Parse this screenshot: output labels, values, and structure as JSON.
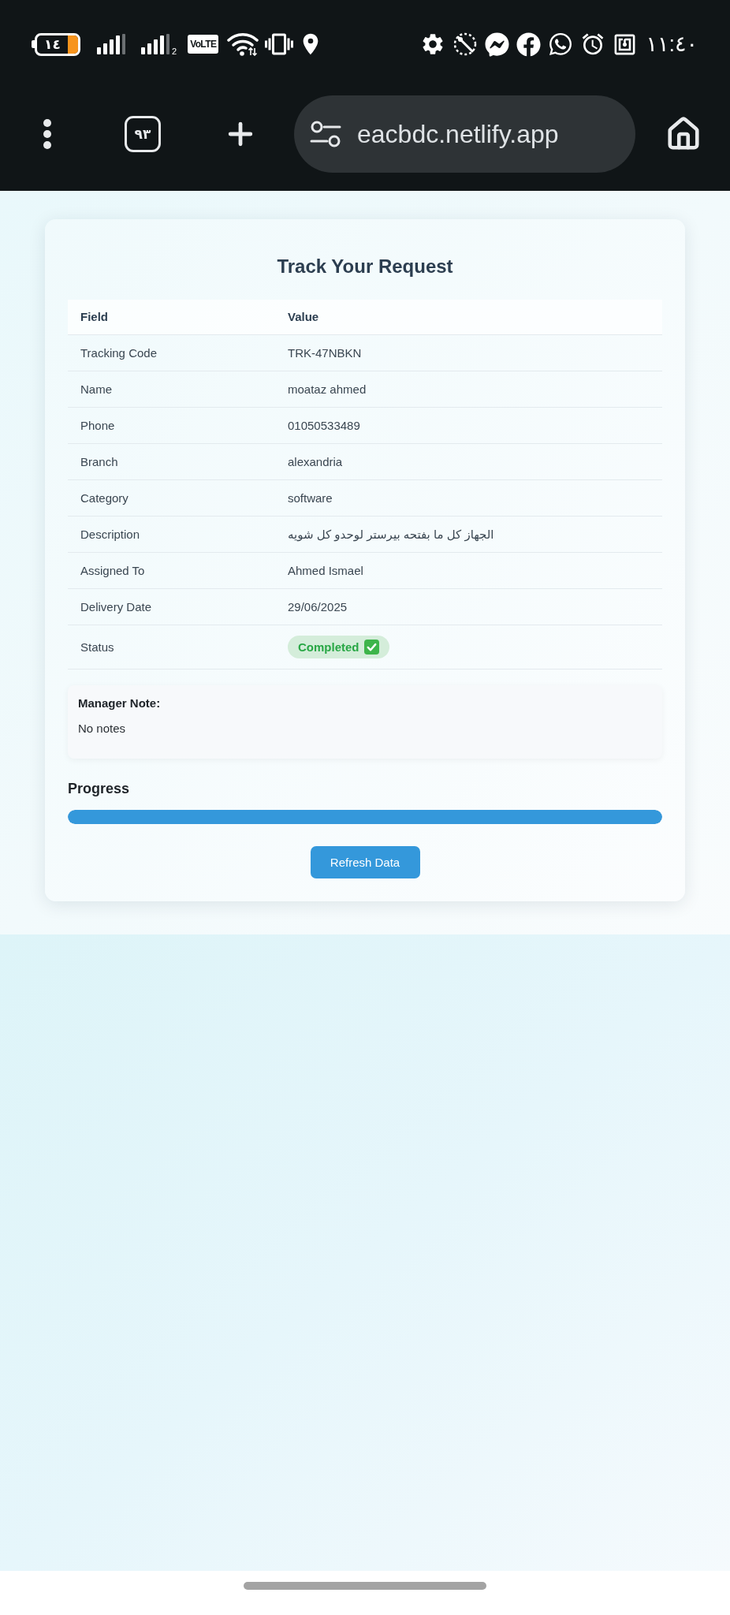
{
  "status_bar": {
    "battery": "١٤",
    "sim_slot": "2",
    "network": "VoLTE",
    "time": "١١:٤٠"
  },
  "browser_bar": {
    "tab_count": "٩٣",
    "url": "eacbdc.netlify.app"
  },
  "card": {
    "title": "Track Your Request",
    "table": {
      "columns": [
        "Field",
        "Value"
      ],
      "rows": [
        {
          "field": "Tracking Code",
          "value": "TRK-47NBKN",
          "kind": "text"
        },
        {
          "field": "Name",
          "value": "moataz ahmed",
          "kind": "text"
        },
        {
          "field": "Phone",
          "value": "01050533489",
          "kind": "text"
        },
        {
          "field": "Branch",
          "value": "alexandria",
          "kind": "text"
        },
        {
          "field": "Category",
          "value": "software",
          "kind": "text"
        },
        {
          "field": "Description",
          "value": "الجهاز كل ما بفتحه بيرستر لوحدو كل شويه",
          "kind": "text"
        },
        {
          "field": "Assigned To",
          "value": "Ahmed Ismael",
          "kind": "text"
        },
        {
          "field": "Delivery Date",
          "value": "29/06/2025",
          "kind": "text"
        },
        {
          "field": "Status",
          "value": "Completed",
          "kind": "badge"
        }
      ]
    },
    "manager_note": {
      "label": "Manager Note:",
      "text": "No notes"
    },
    "progress": {
      "label": "Progress",
      "level": 1
    },
    "button": "Refresh Data"
  }
}
